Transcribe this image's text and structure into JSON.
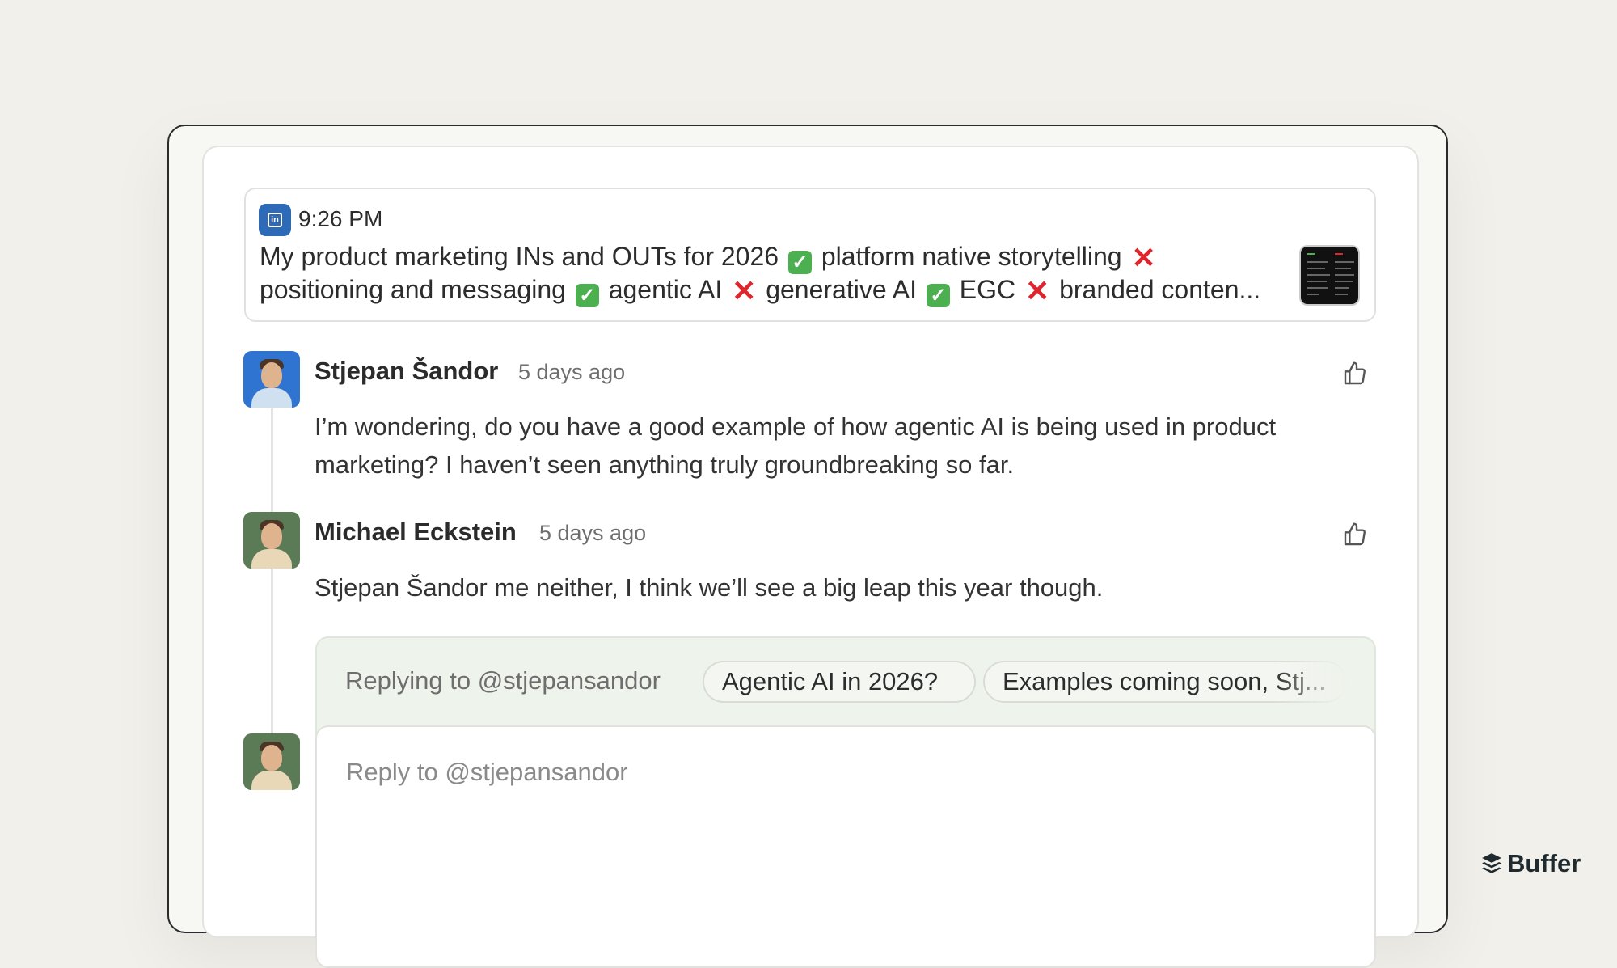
{
  "post": {
    "time": "9:26 PM",
    "network_icon": "linkedin-icon",
    "segments": [
      {
        "type": "text",
        "value": "My product marketing INs and OUTs for 2026 "
      },
      {
        "type": "check"
      },
      {
        "type": "text",
        "value": " platform native storytelling "
      },
      {
        "type": "x"
      },
      {
        "type": "text",
        "value": " positioning and messaging "
      },
      {
        "type": "check"
      },
      {
        "type": "text",
        "value": " agentic AI "
      },
      {
        "type": "x"
      },
      {
        "type": "text",
        "value": " generative AI "
      },
      {
        "type": "check"
      },
      {
        "type": "text",
        "value": " EGC "
      },
      {
        "type": "x"
      },
      {
        "type": "text",
        "value": " branded conten..."
      }
    ]
  },
  "comments": [
    {
      "name": "Stjepan Šandor",
      "time": "5 days ago",
      "text": "I’m wondering, do you have a good example of how agentic AI is being used in product marketing? I haven’t seen anything truly groundbreaking so far."
    },
    {
      "name": "Michael Eckstein",
      "time": "5 days ago",
      "text": "Stjepan Šandor me neither, I think we’ll see a big leap this year though."
    }
  ],
  "reply": {
    "replying_to": "Replying to @stjepansandor",
    "suggestions": [
      "Agentic AI in 2026?",
      "Examples coming soon, Stj..."
    ],
    "placeholder": "Reply to @stjepansandor"
  },
  "brand": {
    "name": "Buffer",
    "icon": "buffer-stack-icon"
  },
  "colors": {
    "background": "#f1f0ea",
    "linkedin": "#2d6ab8",
    "check": "#4caf50",
    "cross": "#e0242b",
    "reply_area": "#eef3eb"
  }
}
